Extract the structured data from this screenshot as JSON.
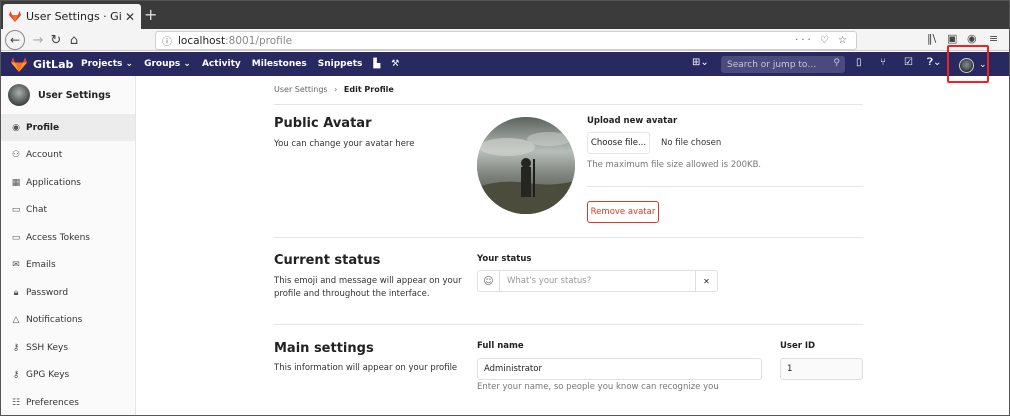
{
  "browser": {
    "tab_title": "User Settings · GitLab",
    "tab_close": "✕",
    "new_tab": "+",
    "url_host": "localhost",
    "url_path": ":8001/profile",
    "url_tools": "··· ♡ ☆"
  },
  "header": {
    "brand": "GitLab",
    "menu": [
      "Projects ⌄",
      "Groups ⌄",
      "Activity",
      "Milestones",
      "Snippets"
    ],
    "search_placeholder": "Search or jump to…",
    "colors": {
      "nav_bg": "#292961",
      "accent_red": "#db3b21"
    }
  },
  "sidebar": {
    "title": "User Settings",
    "items": [
      {
        "label": "Profile",
        "icon": "user-circle-icon",
        "glyph": "◉"
      },
      {
        "label": "Account",
        "icon": "account-icon",
        "glyph": "⚇"
      },
      {
        "label": "Applications",
        "icon": "applications-grid-icon",
        "glyph": "▦"
      },
      {
        "label": "Chat",
        "icon": "chat-icon",
        "glyph": "▭"
      },
      {
        "label": "Access Tokens",
        "icon": "token-icon",
        "glyph": "▭"
      },
      {
        "label": "Emails",
        "icon": "envelope-icon",
        "glyph": "✉"
      },
      {
        "label": "Password",
        "icon": "lock-icon",
        "glyph": "🔒︎"
      },
      {
        "label": "Notifications",
        "icon": "bell-icon",
        "glyph": "△"
      },
      {
        "label": "SSH Keys",
        "icon": "key-icon",
        "glyph": "⚷"
      },
      {
        "label": "GPG Keys",
        "icon": "key-icon",
        "glyph": "⚷"
      },
      {
        "label": "Preferences",
        "icon": "sliders-icon",
        "glyph": "☷"
      }
    ]
  },
  "breadcrumb": {
    "parent": "User Settings",
    "sep": "›",
    "current": "Edit Profile"
  },
  "avatar_section": {
    "title": "Public Avatar",
    "description": "You can change your avatar here",
    "upload_label": "Upload new avatar",
    "choose_file": "Choose file...",
    "no_file": "No file chosen",
    "size_note": "The maximum file size allowed is 200KB.",
    "remove_button": "Remove avatar"
  },
  "status_section": {
    "title": "Current status",
    "description": "This emoji and message will appear on your profile and throughout the interface.",
    "label": "Your status",
    "placeholder": "What's your status?",
    "clear": "✕"
  },
  "main_section": {
    "title": "Main settings",
    "description": "This information will appear on your profile",
    "full_name_label": "Full name",
    "full_name_value": "Administrator",
    "full_name_help": "Enter your name, so people you know can recognize you",
    "user_id_label": "User ID",
    "user_id_value": "1"
  }
}
